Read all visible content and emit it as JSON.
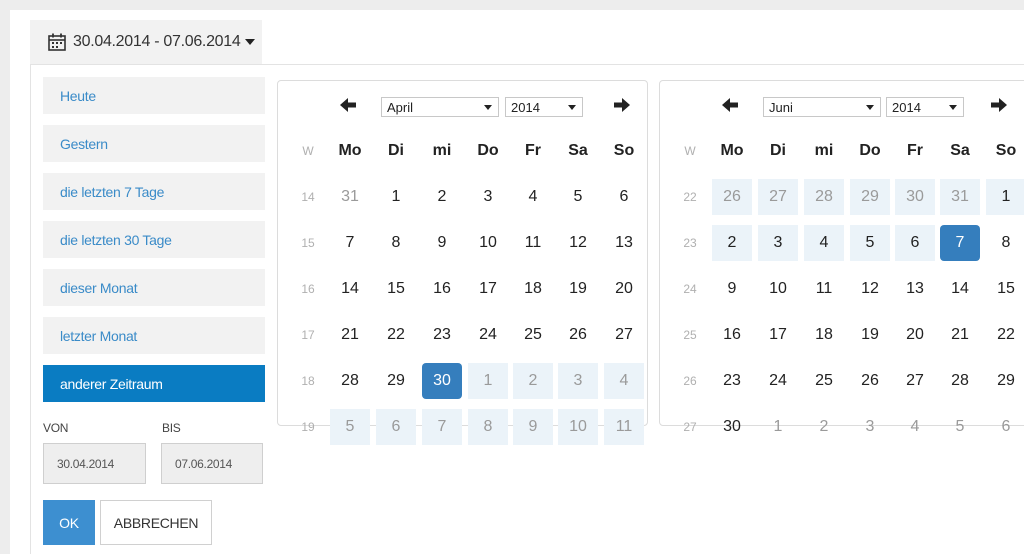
{
  "trigger": {
    "label": "30.04.2014 - 07.06.2014"
  },
  "ranges": [
    {
      "label": "Heute",
      "active": false
    },
    {
      "label": "Gestern",
      "active": false
    },
    {
      "label": "die letzten 7 Tage",
      "active": false
    },
    {
      "label": "die letzten 30 Tage",
      "active": false
    },
    {
      "label": "dieser Monat",
      "active": false
    },
    {
      "label": "letzter Monat",
      "active": false
    },
    {
      "label": "anderer Zeitraum",
      "active": true
    }
  ],
  "form": {
    "from_label": "VON",
    "to_label": "BIS",
    "from_value": "30.04.2014",
    "to_value": "07.06.2014",
    "ok_label": "OK",
    "cancel_label": "ABBRECHEN"
  },
  "colors": {
    "accent": "#0a7cc2",
    "selected": "#357ebd",
    "range": "#ebf3f9",
    "link": "#3a8bc8"
  },
  "weekday_header": [
    "W",
    "Mo",
    "Di",
    "mi",
    "Do",
    "Fr",
    "Sa",
    "So"
  ],
  "calendars": [
    {
      "month": "April",
      "year": "2014",
      "weeks": [
        {
          "wk": "14",
          "days": [
            {
              "d": "31",
              "s": "off-in"
            },
            {
              "d": "1"
            },
            {
              "d": "2"
            },
            {
              "d": "3"
            },
            {
              "d": "4"
            },
            {
              "d": "5"
            },
            {
              "d": "6"
            }
          ]
        },
        {
          "wk": "15",
          "days": [
            {
              "d": "7"
            },
            {
              "d": "8"
            },
            {
              "d": "9"
            },
            {
              "d": "10"
            },
            {
              "d": "11"
            },
            {
              "d": "12"
            },
            {
              "d": "13"
            }
          ]
        },
        {
          "wk": "16",
          "days": [
            {
              "d": "14"
            },
            {
              "d": "15"
            },
            {
              "d": "16"
            },
            {
              "d": "17"
            },
            {
              "d": "18"
            },
            {
              "d": "19"
            },
            {
              "d": "20"
            }
          ]
        },
        {
          "wk": "17",
          "days": [
            {
              "d": "21"
            },
            {
              "d": "22"
            },
            {
              "d": "23"
            },
            {
              "d": "24"
            },
            {
              "d": "25"
            },
            {
              "d": "26"
            },
            {
              "d": "27"
            }
          ]
        },
        {
          "wk": "18",
          "days": [
            {
              "d": "28"
            },
            {
              "d": "29"
            },
            {
              "d": "30",
              "s": "sel"
            },
            {
              "d": "1",
              "s": "off-range"
            },
            {
              "d": "2",
              "s": "off-range"
            },
            {
              "d": "3",
              "s": "off-range"
            },
            {
              "d": "4",
              "s": "off-range"
            }
          ]
        },
        {
          "wk": "19",
          "days": [
            {
              "d": "5",
              "s": "off-range"
            },
            {
              "d": "6",
              "s": "off-range"
            },
            {
              "d": "7",
              "s": "off-range"
            },
            {
              "d": "8",
              "s": "off-range"
            },
            {
              "d": "9",
              "s": "off-range"
            },
            {
              "d": "10",
              "s": "off-range"
            },
            {
              "d": "11",
              "s": "off-range"
            }
          ]
        }
      ]
    },
    {
      "month": "Juni",
      "year": "2014",
      "weeks": [
        {
          "wk": "22",
          "days": [
            {
              "d": "26",
              "s": "off-range"
            },
            {
              "d": "27",
              "s": "off-range"
            },
            {
              "d": "28",
              "s": "off-range"
            },
            {
              "d": "29",
              "s": "off-range"
            },
            {
              "d": "30",
              "s": "off-range"
            },
            {
              "d": "31",
              "s": "off-range"
            },
            {
              "d": "1",
              "s": "range"
            }
          ]
        },
        {
          "wk": "23",
          "days": [
            {
              "d": "2",
              "s": "range"
            },
            {
              "d": "3",
              "s": "range"
            },
            {
              "d": "4",
              "s": "range"
            },
            {
              "d": "5",
              "s": "range"
            },
            {
              "d": "6",
              "s": "range"
            },
            {
              "d": "7",
              "s": "sel"
            },
            {
              "d": "8"
            }
          ]
        },
        {
          "wk": "24",
          "days": [
            {
              "d": "9"
            },
            {
              "d": "10"
            },
            {
              "d": "11"
            },
            {
              "d": "12"
            },
            {
              "d": "13"
            },
            {
              "d": "14"
            },
            {
              "d": "15"
            }
          ]
        },
        {
          "wk": "25",
          "days": [
            {
              "d": "16"
            },
            {
              "d": "17"
            },
            {
              "d": "18"
            },
            {
              "d": "19"
            },
            {
              "d": "20"
            },
            {
              "d": "21"
            },
            {
              "d": "22"
            }
          ]
        },
        {
          "wk": "26",
          "days": [
            {
              "d": "23"
            },
            {
              "d": "24"
            },
            {
              "d": "25"
            },
            {
              "d": "26"
            },
            {
              "d": "27"
            },
            {
              "d": "28"
            },
            {
              "d": "29"
            }
          ]
        },
        {
          "wk": "27",
          "days": [
            {
              "d": "30"
            },
            {
              "d": "1",
              "s": "off"
            },
            {
              "d": "2",
              "s": "off"
            },
            {
              "d": "3",
              "s": "off"
            },
            {
              "d": "4",
              "s": "off"
            },
            {
              "d": "5",
              "s": "off"
            },
            {
              "d": "6",
              "s": "off"
            }
          ]
        }
      ]
    }
  ]
}
